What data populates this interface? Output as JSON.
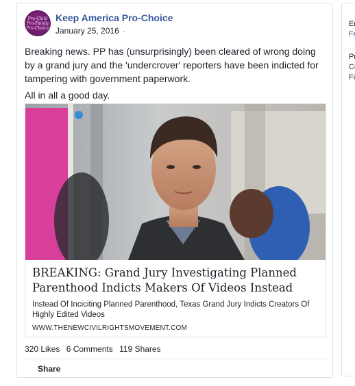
{
  "post": {
    "page_name": "Keep America Pro-Choice",
    "avatar_text": [
      "Pro-Child",
      "Pro-Family",
      "Pro-Choice"
    ],
    "date": "January 25, 2016",
    "date_separator": "·",
    "body": [
      "Breaking news. PP has (unsurprisingly) been cleared of wrong doing by a grand jury and the 'undercrover' reporters have been indicted for tampering with government paperwork.",
      "All in all a good day."
    ],
    "link": {
      "title": "BREAKING: Grand Jury Investigating Planned Parenthood Indicts Makers Of Videos Instead",
      "description": "Instead Of Inciciting Planned Parenthood, Texas Grand Jury Indicts Creators Of Highly Edited Videos",
      "domain": "WWW.THENEWCIVILRIGHTSMOVEMENT.COM"
    },
    "stats": {
      "likes": "320 Likes",
      "comments": "6 Comments",
      "shares": "119 Shares"
    },
    "share_label": "Share"
  },
  "side_card": {
    "lines": [
      "Er",
      "Fr",
      "Pr",
      "Co",
      "Fa"
    ]
  },
  "colors": {
    "link_blue": "#365899",
    "border": "#dddfe2",
    "text": "#1d2129"
  }
}
